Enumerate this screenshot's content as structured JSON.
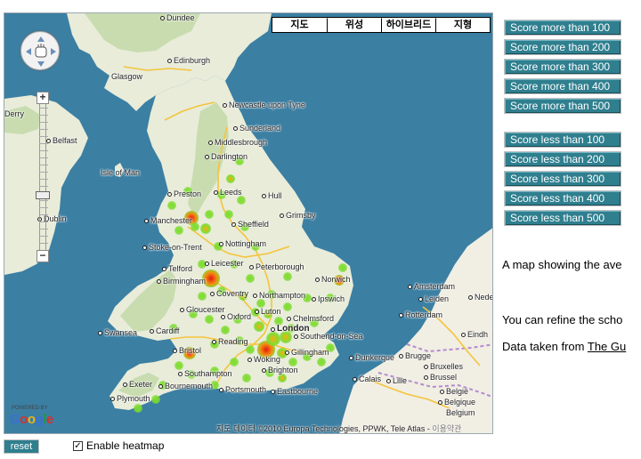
{
  "map": {
    "type_buttons": [
      "지도",
      "위성",
      "하이브리드",
      "지형"
    ],
    "attribution_text": "지도 데이터 ©2010 Europa Technologies, PPWK, Tele Atlas -",
    "attribution_terms": "이용약관",
    "logo_text": "Google",
    "logo_powered": "POWERED BY",
    "zoom_in": "+",
    "zoom_out": "−",
    "colors": {
      "sea": "#3b7fa3",
      "land": "#e8ecd9",
      "highland": "#c9dcb0",
      "continent": "#f1eee3",
      "heat_low": "#7ddc2e",
      "heat_high": "#e01a10"
    },
    "places": [
      {
        "name": "Dundee"
      },
      {
        "name": "Edinburgh"
      },
      {
        "name": "Glasgow"
      },
      {
        "name": "Newcastle upon Tyne"
      },
      {
        "name": "Sunderland"
      },
      {
        "name": "Middlesbrough"
      },
      {
        "name": "Darlington"
      },
      {
        "name": "Isle of Man"
      },
      {
        "name": "Belfast"
      },
      {
        "name": "Derry"
      },
      {
        "name": "Dublin"
      },
      {
        "name": "Preston"
      },
      {
        "name": "Leeds"
      },
      {
        "name": "Hull"
      },
      {
        "name": "Manchester"
      },
      {
        "name": "Grimsby"
      },
      {
        "name": "Sheffield"
      },
      {
        "name": "Stoke-on-Trent"
      },
      {
        "name": "Nottingham"
      },
      {
        "name": "Telford"
      },
      {
        "name": "Leicester"
      },
      {
        "name": "Peterborough"
      },
      {
        "name": "Birmingham"
      },
      {
        "name": "Norwich"
      },
      {
        "name": "Coventry"
      },
      {
        "name": "Northampton"
      },
      {
        "name": "Ipswich"
      },
      {
        "name": "Gloucester"
      },
      {
        "name": "Luton"
      },
      {
        "name": "Oxford"
      },
      {
        "name": "Chelmsford"
      },
      {
        "name": "Swansea"
      },
      {
        "name": "Cardiff"
      },
      {
        "name": "London"
      },
      {
        "name": "Southend-on-Sea"
      },
      {
        "name": "Reading"
      },
      {
        "name": "Bristol"
      },
      {
        "name": "Gillingham"
      },
      {
        "name": "Woking"
      },
      {
        "name": "Southampton"
      },
      {
        "name": "Brighton"
      },
      {
        "name": "Exeter"
      },
      {
        "name": "Bournemouth"
      },
      {
        "name": "Portsmouth"
      },
      {
        "name": "Eastbourne"
      },
      {
        "name": "Plymouth"
      },
      {
        "name": "Amsterdam"
      },
      {
        "name": "Leiden"
      },
      {
        "name": "Rotterdam"
      },
      {
        "name": "Eindh"
      },
      {
        "name": "Dunkerque"
      },
      {
        "name": "Brugge"
      },
      {
        "name": "Bruxelles"
      },
      {
        "name": "Brussel"
      },
      {
        "name": "Calais"
      },
      {
        "name": "Lille"
      },
      {
        "name": "België"
      },
      {
        "name": "Belgique"
      },
      {
        "name": "Belgium"
      },
      {
        "name": "Nede"
      }
    ]
  },
  "filters": {
    "more": [
      "Score more than 100",
      "Score more than 200",
      "Score more than 300",
      "Score more than 400",
      "Score more than 500"
    ],
    "less": [
      "Score less than 100",
      "Score less than 200",
      "Score less than 300",
      "Score less than 400",
      "Score less than 500"
    ]
  },
  "info": {
    "line1": "A map showing the ave",
    "line2": "You can refine the scho",
    "line3_prefix": "Data taken from ",
    "line3_link": "The Gu"
  },
  "controls": {
    "reset_label": "reset",
    "heatmap_label": "Enable heatmap",
    "heatmap_checked": true
  }
}
